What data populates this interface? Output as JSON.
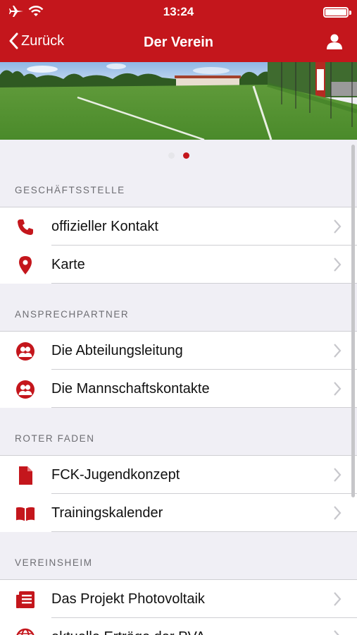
{
  "status": {
    "time": "13:24"
  },
  "nav": {
    "back_label": "Zurück",
    "title": "Der Verein"
  },
  "carousel": {
    "page_count": 2,
    "current_page": 2
  },
  "sections": [
    {
      "header": "GESCHÄFTSSTELLE",
      "items": [
        {
          "label": "offizieller Kontakt",
          "icon": "phone-icon"
        },
        {
          "label": "Karte",
          "icon": "map-pin-icon"
        }
      ]
    },
    {
      "header": "ANSPRECHPARTNER",
      "items": [
        {
          "label": "Die Abteilungsleitung",
          "icon": "people-icon"
        },
        {
          "label": "Die Mannschaftskontakte",
          "icon": "people-icon"
        }
      ]
    },
    {
      "header": "ROTER FADEN",
      "items": [
        {
          "label": "FCK-Jugendkonzept",
          "icon": "document-icon"
        },
        {
          "label": "Trainingskalender",
          "icon": "book-icon"
        }
      ]
    },
    {
      "header": "VEREINSHEIM",
      "items": [
        {
          "label": "Das Projekt Photovoltaik",
          "icon": "list-document-icon"
        },
        {
          "label": "aktuelle Erträge der PVA",
          "icon": "globe-icon"
        }
      ]
    }
  ],
  "colors": {
    "accent": "#c4161c",
    "background": "#f0eff5",
    "separator": "#cfcfd3",
    "section_text": "#6d6d72"
  }
}
